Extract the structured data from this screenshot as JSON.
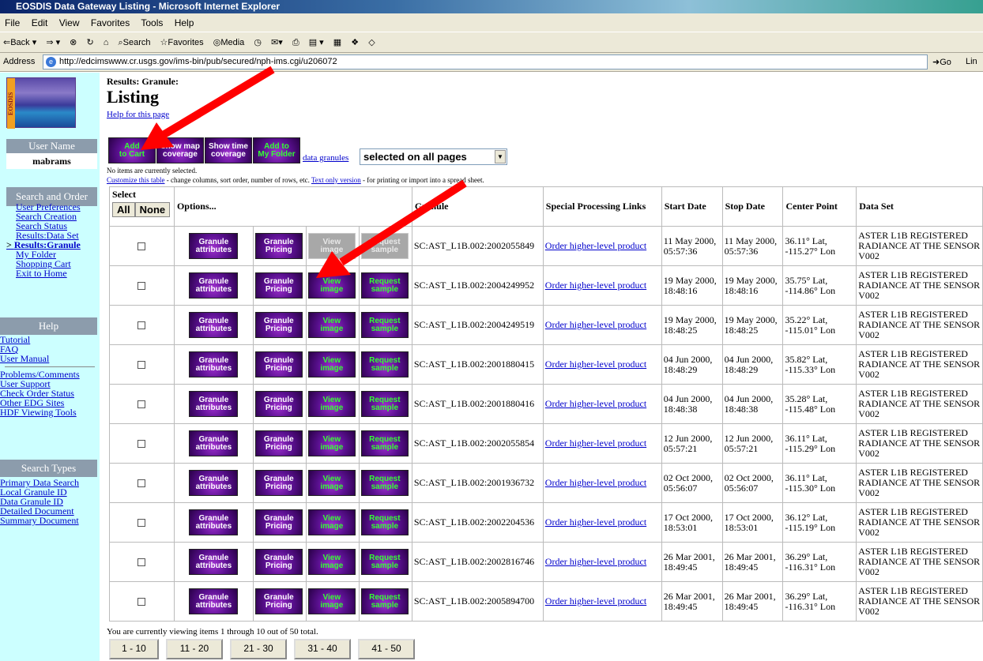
{
  "window": {
    "title": "EOSDIS Data Gateway Listing - Microsoft Internet Explorer"
  },
  "menu": [
    "File",
    "Edit",
    "View",
    "Favorites",
    "Tools",
    "Help"
  ],
  "toolbar": {
    "back": "⇐Back ▾",
    "fwd": "⇒ ▾",
    "stop": "⊗",
    "refresh": "↻",
    "home": "⌂",
    "search": "Search",
    "favorites": "Favorites",
    "media": "Media",
    "history": "◷",
    "mail": "✉▾",
    "print": "⎙",
    "edit": "▤ ▾",
    "discuss": "▦",
    "msg": "❖",
    "other": "◇"
  },
  "address": {
    "label": "Address",
    "url": "http://edcimswww.cr.usgs.gov/ims-bin/pub/secured/nph-ims.cgi/u206072",
    "go": "Go",
    "links": "Lin"
  },
  "sidebar": {
    "logo_text": "EOSDIS",
    "user_label": "User Name",
    "user_value": "mabrams",
    "search_order_label": "Search and Order",
    "search_order_items": [
      "User Preferences",
      "Search Creation",
      "Search Status",
      "Results:Data Set",
      "Results:Granule",
      "My Folder",
      "Shopping Cart",
      "Exit to Home"
    ],
    "help_label": "Help",
    "help_items": [
      "Tutorial",
      "FAQ",
      "User Manual"
    ],
    "help_items2": [
      "Problems/Comments",
      "User Support",
      "Check Order Status",
      "Other EDG Sites",
      "HDF Viewing Tools"
    ],
    "search_types_label": "Search Types",
    "search_types_items": [
      "Primary Data Search",
      "Local Granule ID",
      "Data Granule ID",
      "Detailed Document",
      "Summary Document"
    ]
  },
  "main": {
    "results_title": "Results: Granule:",
    "heading": "Listing",
    "help_link": "Help for this page",
    "top_buttons": [
      "Add\nto Cart",
      "Show map\ncoverage",
      "Show time\ncoverage",
      "Add to\nMy Folder"
    ],
    "data_granules_link": "data granules",
    "scope_select": "selected on all pages",
    "no_items": "No items are currently selected.",
    "customize_link": "Customize this table",
    "customize_text": " - change columns, sort order, number of rows, etc. ",
    "text_only_link": "Text only version",
    "text_only_text": " - for printing or import into a spread sheet."
  },
  "table": {
    "headers": {
      "select": "Select",
      "all": "All",
      "none": "None",
      "options": "Options...",
      "granule": "Granule",
      "special": "Special Processing Links",
      "start": "Start Date",
      "stop": "Stop Date",
      "center": "Center Point",
      "dataset": "Data Set"
    },
    "btn_attr": "Granule\nattributes",
    "btn_price": "Granule\nPricing",
    "btn_view": "View\nimage",
    "btn_req": "Request\nsample",
    "order_link": "Order higher-level product",
    "rows": [
      {
        "id": "SC:AST_L1B.002:2002055849",
        "start": "11 May 2000, 05:57:36",
        "stop": "11 May 2000, 05:57:36",
        "center": "36.11° Lat, -115.27° Lon",
        "dataset": "ASTER L1B REGISTERED RADIANCE AT THE SENSOR V002",
        "disabled": true
      },
      {
        "id": "SC:AST_L1B.002:2004249952",
        "start": "19 May 2000, 18:48:16",
        "stop": "19 May 2000, 18:48:16",
        "center": "35.75° Lat, -114.86° Lon",
        "dataset": "ASTER L1B REGISTERED RADIANCE AT THE SENSOR V002",
        "disabled": false
      },
      {
        "id": "SC:AST_L1B.002:2004249519",
        "start": "19 May 2000, 18:48:25",
        "stop": "19 May 2000, 18:48:25",
        "center": "35.22° Lat, -115.01° Lon",
        "dataset": "ASTER L1B REGISTERED RADIANCE AT THE SENSOR V002",
        "disabled": false
      },
      {
        "id": "SC:AST_L1B.002:2001880415",
        "start": "04 Jun 2000, 18:48:29",
        "stop": "04 Jun 2000, 18:48:29",
        "center": "35.82° Lat, -115.33° Lon",
        "dataset": "ASTER L1B REGISTERED RADIANCE AT THE SENSOR V002",
        "disabled": false
      },
      {
        "id": "SC:AST_L1B.002:2001880416",
        "start": "04 Jun 2000, 18:48:38",
        "stop": "04 Jun 2000, 18:48:38",
        "center": "35.28° Lat, -115.48° Lon",
        "dataset": "ASTER L1B REGISTERED RADIANCE AT THE SENSOR V002",
        "disabled": false
      },
      {
        "id": "SC:AST_L1B.002:2002055854",
        "start": "12 Jun 2000, 05:57:21",
        "stop": "12 Jun 2000, 05:57:21",
        "center": "36.11° Lat, -115.29° Lon",
        "dataset": "ASTER L1B REGISTERED RADIANCE AT THE SENSOR V002",
        "disabled": false
      },
      {
        "id": "SC:AST_L1B.002:2001936732",
        "start": "02 Oct 2000, 05:56:07",
        "stop": "02 Oct 2000, 05:56:07",
        "center": "36.11° Lat, -115.30° Lon",
        "dataset": "ASTER L1B REGISTERED RADIANCE AT THE SENSOR V002",
        "disabled": false
      },
      {
        "id": "SC:AST_L1B.002:2002204536",
        "start": "17 Oct 2000, 18:53:01",
        "stop": "17 Oct 2000, 18:53:01",
        "center": "36.12° Lat, -115.19° Lon",
        "dataset": "ASTER L1B REGISTERED RADIANCE AT THE SENSOR V002",
        "disabled": false
      },
      {
        "id": "SC:AST_L1B.002:2002816746",
        "start": "26 Mar 2001, 18:49:45",
        "stop": "26 Mar 2001, 18:49:45",
        "center": "36.29° Lat, -116.31° Lon",
        "dataset": "ASTER L1B REGISTERED RADIANCE AT THE SENSOR V002",
        "disabled": false
      },
      {
        "id": "SC:AST_L1B.002:2005894700",
        "start": "26 Mar 2001, 18:49:45",
        "stop": "26 Mar 2001, 18:49:45",
        "center": "36.29° Lat, -116.31° Lon",
        "dataset": "ASTER L1B REGISTERED RADIANCE AT THE SENSOR V002",
        "disabled": false
      }
    ]
  },
  "footer": {
    "viewing": "You are currently viewing items 1 through 10 out of 50 total.",
    "pages": [
      "1 - 10",
      "11 - 20",
      "21 - 30",
      "31 - 40",
      "41 - 50"
    ]
  },
  "colors": {
    "sidebar_bg": "#ccffff",
    "button_purple": "#5a1090",
    "button_green_text": "#33ff33",
    "arrow": "#ff0000"
  }
}
